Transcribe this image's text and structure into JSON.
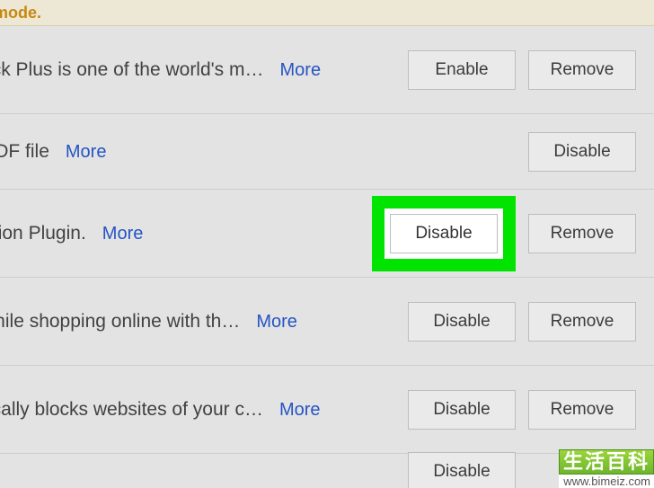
{
  "banner": {
    "text": "…e mode."
  },
  "labels": {
    "more": "More",
    "enable": "Enable",
    "disable": "Disable",
    "remove": "Remove"
  },
  "rows": [
    {
      "desc": "…dblock Plus is one of the world's m…",
      "primary": "enable",
      "secondary": "remove",
      "highlighted": false
    },
    {
      "desc": "…be PDF file",
      "primary": null,
      "secondary": "disable",
      "highlighted": false
    },
    {
      "desc": "…putation Plugin.",
      "primary": "disable",
      "secondary": "remove",
      "highlighted": true
    },
    {
      "desc": "…ns while shopping online with th…",
      "primary": "disable",
      "secondary": "remove",
      "highlighted": false
    },
    {
      "desc": "…matically blocks websites of your c…",
      "primary": "disable",
      "secondary": "remove",
      "highlighted": false
    },
    {
      "desc": "",
      "primary": "disable",
      "secondary": null,
      "highlighted": false
    }
  ],
  "watermark": {
    "cn": "生活百科",
    "url": "www.bimeiz.com"
  }
}
